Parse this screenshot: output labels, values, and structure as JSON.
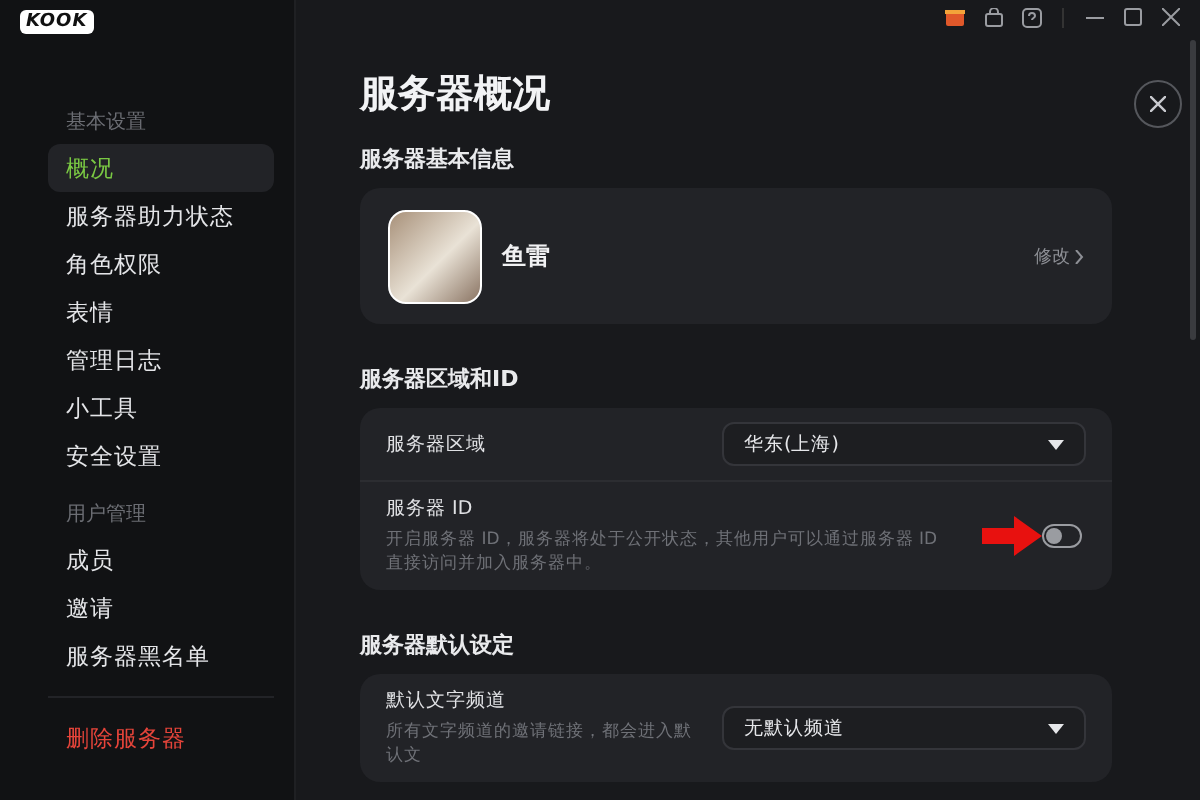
{
  "app": {
    "logo": "KOOK"
  },
  "sidebar": {
    "groups": [
      {
        "title": "基本设置",
        "items": [
          {
            "label": "概况",
            "selected": true
          },
          {
            "label": "服务器助力状态",
            "selected": false
          },
          {
            "label": "角色权限",
            "selected": false
          },
          {
            "label": "表情",
            "selected": false
          },
          {
            "label": "管理日志",
            "selected": false
          },
          {
            "label": "小工具",
            "selected": false
          },
          {
            "label": "安全设置",
            "selected": false
          }
        ]
      },
      {
        "title": "用户管理",
        "items": [
          {
            "label": "成员",
            "selected": false
          },
          {
            "label": "邀请",
            "selected": false
          },
          {
            "label": "服务器黑名单",
            "selected": false
          }
        ]
      }
    ],
    "danger_action": "删除服务器"
  },
  "page": {
    "title": "服务器概况",
    "basic_info": {
      "title": "服务器基本信息",
      "server_name": "鱼雷",
      "edit_link": "修改"
    },
    "region_section": {
      "title": "服务器区域和ID",
      "rows": [
        {
          "kind": "select",
          "label": "服务器区域",
          "value": "华东(上海)"
        },
        {
          "kind": "toggle",
          "label": "服务器 ID",
          "description": "开启服务器 ID，服务器将处于公开状态，其他用户可以通过服务器 ID 直接访问并加入服务器中。",
          "on": false
        }
      ]
    },
    "defaults_section": {
      "title": "服务器默认设定",
      "rows": [
        {
          "kind": "select",
          "label": "默认文字频道",
          "description": "所有文字频道的邀请链接，都会进入默认文",
          "value": "无默认频道"
        }
      ]
    }
  }
}
